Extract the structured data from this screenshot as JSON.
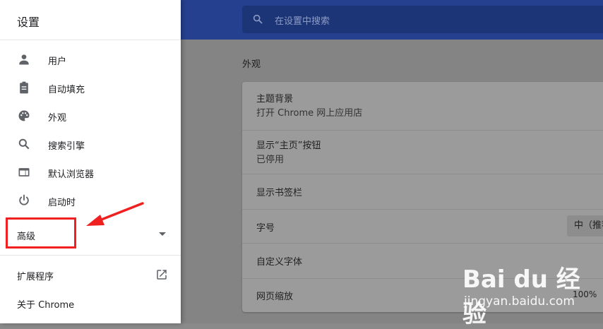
{
  "header": {
    "search_placeholder": "在设置中搜索"
  },
  "main": {
    "section_title": "外观",
    "rows": [
      {
        "title": "主题背景",
        "subtitle": "打开 Chrome 网上应用店"
      },
      {
        "title": "显示“主页”按钮",
        "subtitle": "已停用"
      },
      {
        "title": "显示书签栏"
      },
      {
        "title": "字号",
        "value": "中（推荐）"
      },
      {
        "title": "自定义字体"
      },
      {
        "title": "网页缩放",
        "value": "100%"
      }
    ]
  },
  "drawer": {
    "title": "设置",
    "items": [
      {
        "label": "用户",
        "icon": "person-icon"
      },
      {
        "label": "自动填充",
        "icon": "clipboard-icon"
      },
      {
        "label": "外观",
        "icon": "palette-icon"
      },
      {
        "label": "搜索引擎",
        "icon": "search-icon"
      },
      {
        "label": "默认浏览器",
        "icon": "browser-icon"
      },
      {
        "label": "启动时",
        "icon": "power-icon"
      }
    ],
    "advanced_label": "高级",
    "extensions_label": "扩展程序",
    "about_label": "关于 Chrome"
  },
  "watermark": {
    "logo": "Bai du 经验",
    "site": "jingyan.baidu.com"
  },
  "colors": {
    "header": "#25408f",
    "annotation": "#f02020"
  }
}
